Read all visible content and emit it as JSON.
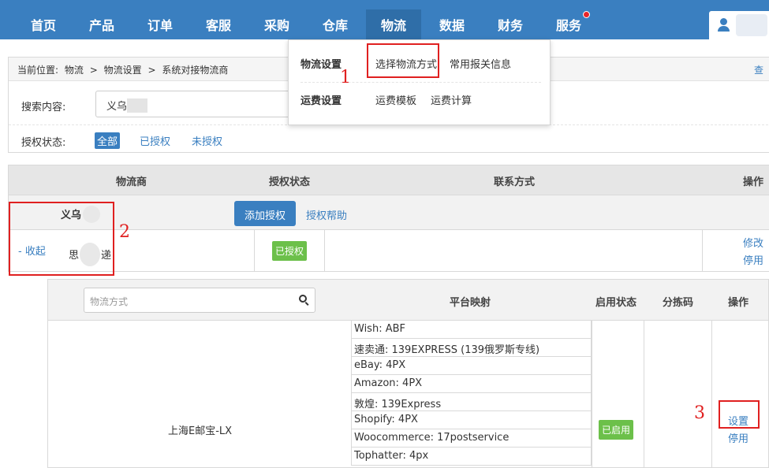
{
  "nav": {
    "items": [
      "首页",
      "产品",
      "订单",
      "客服",
      "采购",
      "仓库",
      "物流",
      "数据",
      "财务",
      "服务"
    ],
    "active_index": 6,
    "badge_index": 9
  },
  "breadcrumb": {
    "prefix": "当前位置:",
    "items": [
      "物流",
      "物流设置",
      "系统对接物流商"
    ],
    "separator": ">",
    "right_link": "查"
  },
  "search": {
    "label": "搜索内容:",
    "value": "义乌"
  },
  "auth_filter": {
    "label": "授权状态:",
    "options": [
      "全部",
      "已授权",
      "未授权"
    ],
    "selected_index": 0
  },
  "dropdown": {
    "sections": [
      {
        "title": "物流设置",
        "links": [
          "选择物流方式",
          "常用报关信息"
        ]
      },
      {
        "title": "运费设置",
        "links": [
          "运费模板",
          "运费计算"
        ]
      }
    ]
  },
  "carrier_table": {
    "headers": [
      "物流商",
      "授权状态",
      "联系方式",
      "操作"
    ],
    "group_name": "义乌",
    "add_button": "添加授权",
    "help_link": "授权帮助",
    "row": {
      "collapse": "- 收起",
      "name_prefix": "思",
      "name_suffix": "递",
      "status": "已授权",
      "actions": [
        "修改",
        "停用"
      ]
    }
  },
  "method_table": {
    "search_placeholder": "物流方式",
    "headers": [
      "平台映射",
      "启用状态",
      "分拣码",
      "操作"
    ],
    "method_name": "上海E邮宝-LX",
    "mappings": [
      "Wish: ABF",
      "速卖通: 139EXPRESS (139俄罗斯专线)",
      "eBay: 4PX",
      "Amazon: 4PX",
      "敦煌: 139Express",
      "Shopify: 4PX",
      "Woocommerce: 17postservice",
      "Tophatter: 4px"
    ],
    "status": "已启用",
    "actions": [
      "设置",
      "停用"
    ]
  },
  "annotations": [
    "1",
    "2",
    "3"
  ],
  "colors": {
    "nav_bg": "#3a7fc0",
    "nav_active": "#2f6ea8",
    "green": "#6cc04a",
    "annotation_red": "#e02020"
  }
}
